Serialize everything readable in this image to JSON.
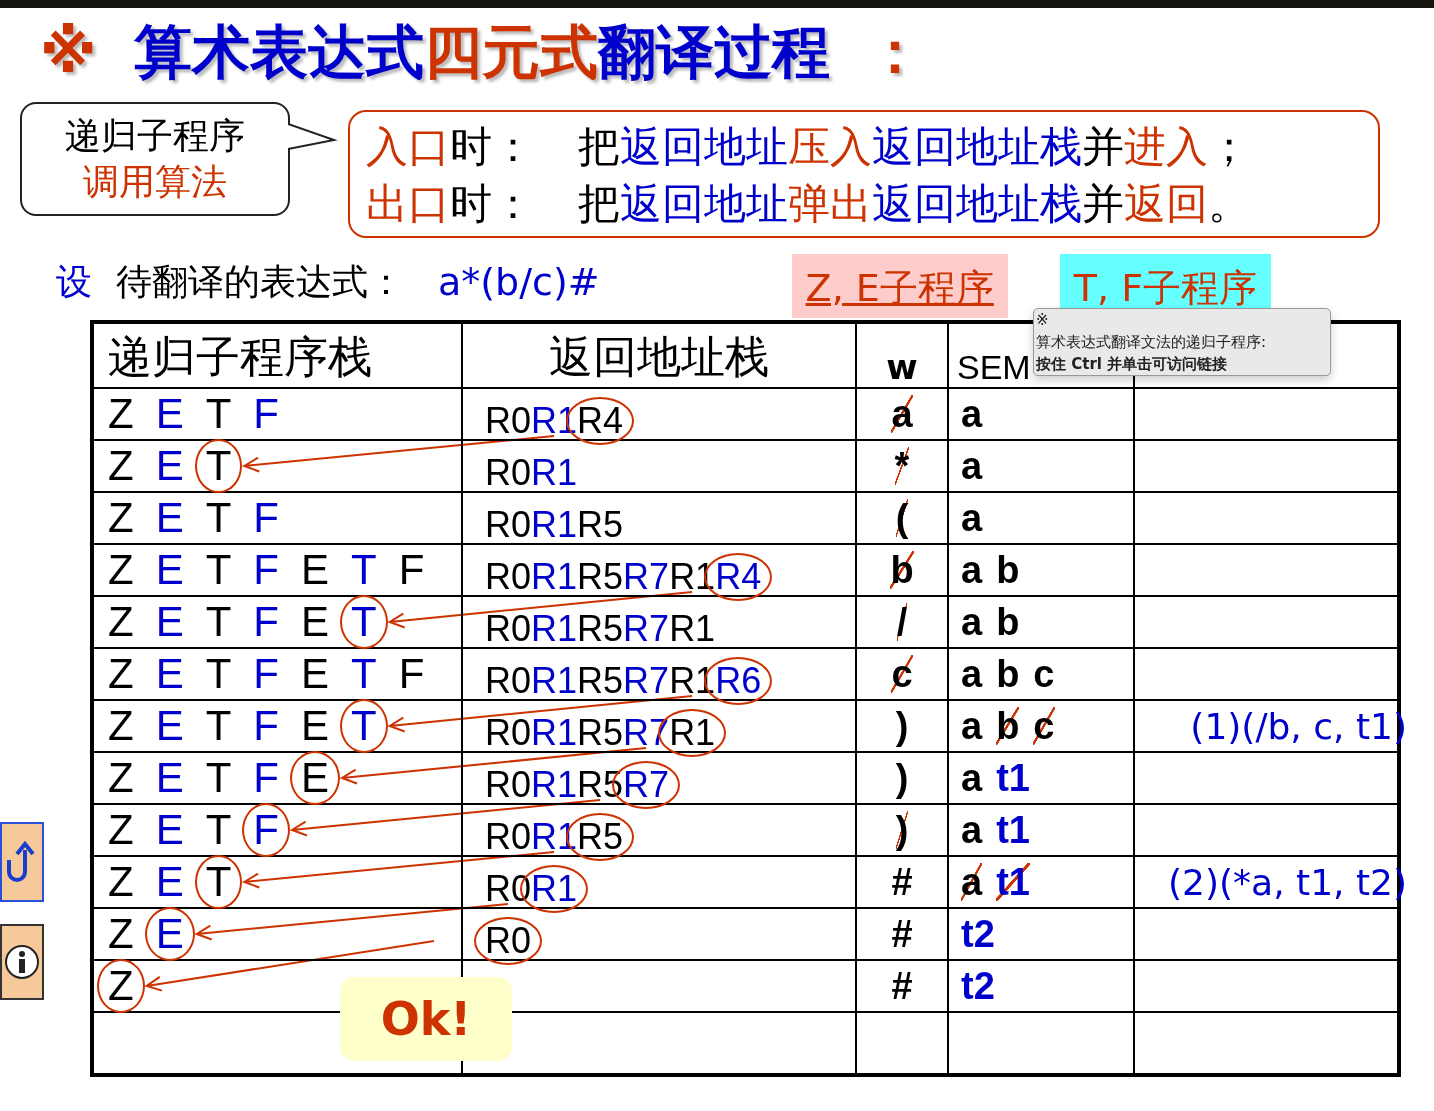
{
  "title": [
    {
      "text": "※",
      "color": "#cc3300"
    },
    {
      "text": "算术表达式",
      "color": "#0000cc"
    },
    {
      "text": "四元式",
      "color": "#cc3300"
    },
    {
      "text": "翻译过程",
      "color": "#0000cc"
    },
    {
      "text": "：",
      "color": "#cc3300"
    }
  ],
  "callout": {
    "line1": "递归子程序",
    "line2": "调用算法"
  },
  "rules": [
    [
      {
        "text": "入口",
        "color": "#cc3300"
      },
      {
        "text": "时：",
        "color": "#000000"
      },
      {
        "text": "把",
        "color": "#000000"
      },
      {
        "text": "返回地址",
        "color": "#0000cc"
      },
      {
        "text": "压入",
        "color": "#cc3300"
      },
      {
        "text": "返回地址栈",
        "color": "#0000cc"
      },
      {
        "text": "并",
        "color": "#000000"
      },
      {
        "text": "进入",
        "color": "#cc3300"
      },
      {
        "text": "；",
        "color": "#000000"
      }
    ],
    [
      {
        "text": "出口",
        "color": "#cc3300"
      },
      {
        "text": "时：",
        "color": "#000000"
      },
      {
        "text": "把",
        "color": "#000000"
      },
      {
        "text": "返回地址",
        "color": "#0000cc"
      },
      {
        "text": "弹出",
        "color": "#cc3300"
      },
      {
        "text": "返回地址栈",
        "color": "#0000cc"
      },
      {
        "text": "并",
        "color": "#000000"
      },
      {
        "text": "返回",
        "color": "#cc3300"
      },
      {
        "text": "。",
        "color": "#000000"
      }
    ]
  ],
  "expression": {
    "prefix": "设",
    "label": "待翻译的表达式：",
    "value": "a*(b/c)#"
  },
  "links": [
    {
      "label": "Z, E子程序",
      "color": "#ffcccc",
      "underlined": true
    },
    {
      "label": "T, F子程序",
      "color": "#66ffff",
      "underlined": false
    }
  ],
  "tooltip": {
    "mark": "※",
    "text": "算术表达式翻译文法的递归子程序:",
    "hint": "按住 Ctrl 并单击可访问链接"
  },
  "table": {
    "columns": [
      "递归子程序栈",
      "返回地址栈",
      "w",
      "SEM"
    ],
    "rows": [
      {
        "stack": [
          {
            "text": "Z",
            "color": "#000000",
            "circled": false
          },
          {
            "text": "E",
            "color": "#0000cc",
            "circled": false
          },
          {
            "text": "T",
            "color": "#000000",
            "circled": false
          },
          {
            "text": "F",
            "color": "#0000cc",
            "circled": false
          }
        ],
        "return_stack": [
          {
            "text": "R0",
            "color": "#000000",
            "circled": false
          },
          {
            "text": "R1",
            "color": "#0000cc",
            "circled": false
          },
          {
            "text": "R4",
            "color": "#000000",
            "circled": true
          }
        ],
        "w": {
          "text": "a",
          "struck": true
        },
        "sem": [
          {
            "text": "a",
            "color": "#000000",
            "struck": false
          }
        ]
      },
      {
        "stack": [
          {
            "text": "Z",
            "color": "#000000",
            "circled": false
          },
          {
            "text": "E",
            "color": "#0000cc",
            "circled": false
          },
          {
            "text": "T",
            "color": "#000000",
            "circled": true
          }
        ],
        "return_stack": [
          {
            "text": "R0",
            "color": "#000000",
            "circled": false
          },
          {
            "text": "R1",
            "color": "#0000cc",
            "circled": false
          }
        ],
        "w": {
          "text": "*",
          "struck": true
        },
        "sem": [
          {
            "text": "a",
            "color": "#000000",
            "struck": false
          }
        ]
      },
      {
        "stack": [
          {
            "text": "Z",
            "color": "#000000",
            "circled": false
          },
          {
            "text": "E",
            "color": "#0000cc",
            "circled": false
          },
          {
            "text": "T",
            "color": "#000000",
            "circled": false
          },
          {
            "text": "F",
            "color": "#0000cc",
            "circled": false
          }
        ],
        "return_stack": [
          {
            "text": "R0",
            "color": "#000000",
            "circled": false
          },
          {
            "text": "R1",
            "color": "#0000cc",
            "circled": false
          },
          {
            "text": "R5",
            "color": "#000000",
            "circled": false
          }
        ],
        "w": {
          "text": "(",
          "struck": true
        },
        "sem": [
          {
            "text": "a",
            "color": "#000000",
            "struck": false
          }
        ]
      },
      {
        "stack": [
          {
            "text": "Z",
            "color": "#000000",
            "circled": false
          },
          {
            "text": "E",
            "color": "#0000cc",
            "circled": false
          },
          {
            "text": "T",
            "color": "#000000",
            "circled": false
          },
          {
            "text": "F",
            "color": "#0000cc",
            "circled": false
          },
          {
            "text": "E",
            "color": "#000000",
            "circled": false
          },
          {
            "text": "T",
            "color": "#0000cc",
            "circled": false
          },
          {
            "text": "F",
            "color": "#000000",
            "circled": false
          }
        ],
        "return_stack": [
          {
            "text": "R0",
            "color": "#000000",
            "circled": false
          },
          {
            "text": "R1",
            "color": "#0000cc",
            "circled": false
          },
          {
            "text": "R5",
            "color": "#000000",
            "circled": false
          },
          {
            "text": "R7",
            "color": "#0000cc",
            "circled": false
          },
          {
            "text": "R1",
            "color": "#000000",
            "circled": false
          },
          {
            "text": "R4",
            "color": "#0000cc",
            "circled": true
          }
        ],
        "w": {
          "text": "b",
          "struck": true
        },
        "sem": [
          {
            "text": "a",
            "color": "#000000",
            "struck": false
          },
          {
            "text": "b",
            "color": "#000000",
            "struck": false
          }
        ]
      },
      {
        "stack": [
          {
            "text": "Z",
            "color": "#000000",
            "circled": false
          },
          {
            "text": "E",
            "color": "#0000cc",
            "circled": false
          },
          {
            "text": "T",
            "color": "#000000",
            "circled": false
          },
          {
            "text": "F",
            "color": "#0000cc",
            "circled": false
          },
          {
            "text": "E",
            "color": "#000000",
            "circled": false
          },
          {
            "text": "T",
            "color": "#0000cc",
            "circled": true
          }
        ],
        "return_stack": [
          {
            "text": "R0",
            "color": "#000000",
            "circled": false
          },
          {
            "text": "R1",
            "color": "#0000cc",
            "circled": false
          },
          {
            "text": "R5",
            "color": "#000000",
            "circled": false
          },
          {
            "text": "R7",
            "color": "#0000cc",
            "circled": false
          },
          {
            "text": "R1",
            "color": "#000000",
            "circled": false
          }
        ],
        "w": {
          "text": "/",
          "struck": true
        },
        "sem": [
          {
            "text": "a",
            "color": "#000000",
            "struck": false
          },
          {
            "text": "b",
            "color": "#000000",
            "struck": false
          }
        ]
      },
      {
        "stack": [
          {
            "text": "Z",
            "color": "#000000",
            "circled": false
          },
          {
            "text": "E",
            "color": "#0000cc",
            "circled": false
          },
          {
            "text": "T",
            "color": "#000000",
            "circled": false
          },
          {
            "text": "F",
            "color": "#0000cc",
            "circled": false
          },
          {
            "text": "E",
            "color": "#000000",
            "circled": false
          },
          {
            "text": "T",
            "color": "#0000cc",
            "circled": false
          },
          {
            "text": "F",
            "color": "#000000",
            "circled": false
          }
        ],
        "return_stack": [
          {
            "text": "R0",
            "color": "#000000",
            "circled": false
          },
          {
            "text": "R1",
            "color": "#0000cc",
            "circled": false
          },
          {
            "text": "R5",
            "color": "#000000",
            "circled": false
          },
          {
            "text": "R7",
            "color": "#0000cc",
            "circled": false
          },
          {
            "text": "R1",
            "color": "#000000",
            "circled": false
          },
          {
            "text": "R6",
            "color": "#0000cc",
            "circled": true
          }
        ],
        "w": {
          "text": "c",
          "struck": true
        },
        "sem": [
          {
            "text": "a",
            "color": "#000000",
            "struck": false
          },
          {
            "text": "b",
            "color": "#000000",
            "struck": false
          },
          {
            "text": "c",
            "color": "#000000",
            "struck": false
          }
        ]
      },
      {
        "stack": [
          {
            "text": "Z",
            "color": "#000000",
            "circled": false
          },
          {
            "text": "E",
            "color": "#0000cc",
            "circled": false
          },
          {
            "text": "T",
            "color": "#000000",
            "circled": false
          },
          {
            "text": "F",
            "color": "#0000cc",
            "circled": false
          },
          {
            "text": "E",
            "color": "#000000",
            "circled": false
          },
          {
            "text": "T",
            "color": "#0000cc",
            "circled": true
          }
        ],
        "return_stack": [
          {
            "text": "R0",
            "color": "#000000",
            "circled": false
          },
          {
            "text": "R1",
            "color": "#0000cc",
            "circled": false
          },
          {
            "text": "R5",
            "color": "#000000",
            "circled": false
          },
          {
            "text": "R7",
            "color": "#0000cc",
            "circled": false
          },
          {
            "text": "R1",
            "color": "#000000",
            "circled": true
          }
        ],
        "w": {
          "text": ")",
          "struck": false
        },
        "sem": [
          {
            "text": "a",
            "color": "#000000",
            "struck": false
          },
          {
            "text": "b",
            "color": "#000000",
            "struck": true
          },
          {
            "text": "c",
            "color": "#000000",
            "struck": true
          }
        ],
        "quad": "(1)(/b, c, t1)"
      },
      {
        "stack": [
          {
            "text": "Z",
            "color": "#000000",
            "circled": false
          },
          {
            "text": "E",
            "color": "#0000cc",
            "circled": false
          },
          {
            "text": "T",
            "color": "#000000",
            "circled": false
          },
          {
            "text": "F",
            "color": "#0000cc",
            "circled": false
          },
          {
            "text": "E",
            "color": "#000000",
            "circled": true
          }
        ],
        "return_stack": [
          {
            "text": "R0",
            "color": "#000000",
            "circled": false
          },
          {
            "text": "R1",
            "color": "#0000cc",
            "circled": false
          },
          {
            "text": "R5",
            "color": "#000000",
            "circled": false
          },
          {
            "text": "R7",
            "color": "#0000cc",
            "circled": true
          }
        ],
        "w": {
          "text": ")",
          "struck": false
        },
        "sem": [
          {
            "text": "a",
            "color": "#000000",
            "struck": false
          },
          {
            "text": "t1",
            "color": "#0000cc",
            "struck": false
          }
        ]
      },
      {
        "stack": [
          {
            "text": "Z",
            "color": "#000000",
            "circled": false
          },
          {
            "text": "E",
            "color": "#0000cc",
            "circled": false
          },
          {
            "text": "T",
            "color": "#000000",
            "circled": false
          },
          {
            "text": "F",
            "color": "#0000cc",
            "circled": true
          }
        ],
        "return_stack": [
          {
            "text": "R0",
            "color": "#000000",
            "circled": false
          },
          {
            "text": "R1",
            "color": "#0000cc",
            "circled": false
          },
          {
            "text": "R5",
            "color": "#000000",
            "circled": true
          }
        ],
        "w": {
          "text": ")",
          "struck": true
        },
        "sem": [
          {
            "text": "a",
            "color": "#000000",
            "struck": false
          },
          {
            "text": "t1",
            "color": "#0000cc",
            "struck": false
          }
        ]
      },
      {
        "stack": [
          {
            "text": "Z",
            "color": "#000000",
            "circled": false
          },
          {
            "text": "E",
            "color": "#0000cc",
            "circled": false
          },
          {
            "text": "T",
            "color": "#000000",
            "circled": true
          }
        ],
        "return_stack": [
          {
            "text": "R0",
            "color": "#000000",
            "circled": false
          },
          {
            "text": "R1",
            "color": "#0000cc",
            "circled": true
          }
        ],
        "w": {
          "text": "#",
          "struck": false
        },
        "sem": [
          {
            "text": "a",
            "color": "#000000",
            "struck": true
          },
          {
            "text": "t1",
            "color": "#0000cc",
            "struck": true
          }
        ],
        "quad": "(2)(*a, t1, t2)"
      },
      {
        "stack": [
          {
            "text": "Z",
            "color": "#000000",
            "circled": false
          },
          {
            "text": "E",
            "color": "#0000cc",
            "circled": true
          }
        ],
        "return_stack": [
          {
            "text": "R0",
            "color": "#000000",
            "circled": true
          }
        ],
        "w": {
          "text": "#",
          "struck": false
        },
        "sem": [
          {
            "text": "t2",
            "color": "#0000cc",
            "struck": false
          }
        ]
      },
      {
        "stack": [
          {
            "text": "Z",
            "color": "#000000",
            "circled": true
          }
        ],
        "w": {
          "text": "#",
          "struck": false
        },
        "sem": [
          {
            "text": "t2",
            "color": "#0000cc",
            "struck": false
          }
        ]
      }
    ]
  },
  "ok_label": "Ok!"
}
